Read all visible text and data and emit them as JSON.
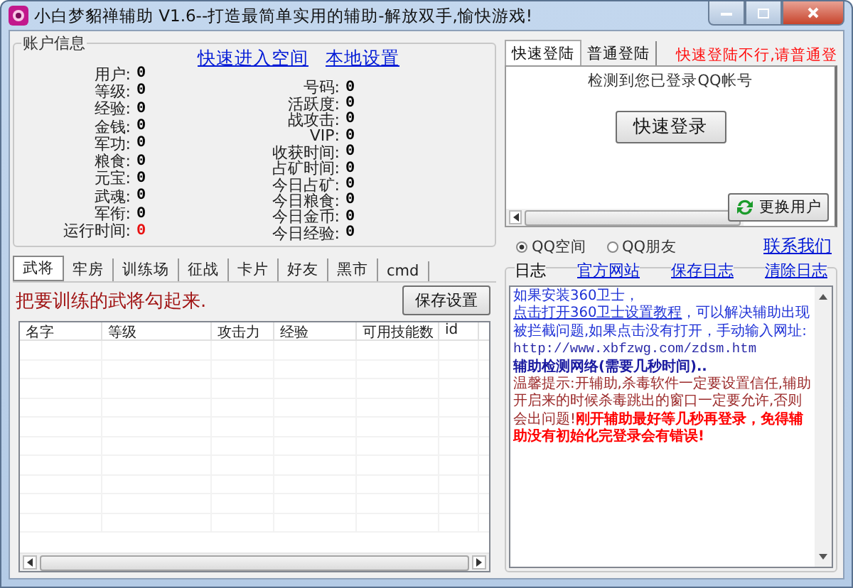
{
  "window": {
    "title": "小白梦貂禅辅助 V1.6--打造最简单实用的辅助-解放双手,愉快游戏!"
  },
  "account": {
    "title": "账户信息",
    "links": [
      "快速进入空间",
      "本地设置"
    ],
    "left_stats": [
      {
        "label": "用户:",
        "value": "0",
        "highlight": false
      },
      {
        "label": "等级:",
        "value": "0",
        "highlight": false
      },
      {
        "label": "经验:",
        "value": "0",
        "highlight": false
      },
      {
        "label": "金钱:",
        "value": "0",
        "highlight": false
      },
      {
        "label": "军功:",
        "value": "0",
        "highlight": false
      },
      {
        "label": "粮食:",
        "value": "0",
        "highlight": false
      },
      {
        "label": "元宝:",
        "value": "0",
        "highlight": false
      },
      {
        "label": "武魂:",
        "value": "0",
        "highlight": false
      },
      {
        "label": "军衔:",
        "value": "0",
        "highlight": false
      },
      {
        "label": "运行时间:",
        "value": "0",
        "highlight": true
      }
    ],
    "right_stats": [
      {
        "label": "号码:",
        "value": "0"
      },
      {
        "label": "活跃度:",
        "value": "0"
      },
      {
        "label": "战攻击:",
        "value": "0"
      },
      {
        "label": "VIP:",
        "value": "0"
      },
      {
        "label": "收获时间:",
        "value": "0"
      },
      {
        "label": "占矿时间:",
        "value": "0"
      },
      {
        "label": "今日占矿:",
        "value": "0"
      },
      {
        "label": "今日粮食:",
        "value": "0"
      },
      {
        "label": "今日金币:",
        "value": "0"
      },
      {
        "label": "今日经验:",
        "value": "0"
      }
    ]
  },
  "main_tabs": [
    {
      "label": "武将",
      "selected": true
    },
    {
      "label": "牢房",
      "selected": false
    },
    {
      "label": "训练场",
      "selected": false
    },
    {
      "label": "征战",
      "selected": false
    },
    {
      "label": "卡片",
      "selected": false
    },
    {
      "label": "好友",
      "selected": false
    },
    {
      "label": "黑市",
      "selected": false
    },
    {
      "label": "cmd",
      "selected": false
    }
  ],
  "hint": "把要训练的武将勾起来.",
  "save_button": "保存设置",
  "table": {
    "columns": [
      "名字",
      "等级",
      "攻击力",
      "经验",
      "可用技能数",
      "id"
    ]
  },
  "login": {
    "tabs": [
      {
        "label": "快速登陆",
        "selected": true
      },
      {
        "label": "普通登陆",
        "selected": false
      }
    ],
    "notice": "快速登陆不行,请普通登",
    "message": "检测到您已登录QQ帐号",
    "login_button": "快速登录",
    "switch_button": "更换用户"
  },
  "radios": [
    {
      "label": "QQ空间",
      "selected": true
    },
    {
      "label": "QQ朋友",
      "selected": false
    }
  ],
  "contact_link": "联系我们",
  "log": {
    "title": "日志",
    "links": [
      "官方网站",
      "保存日志",
      "清除日志"
    ],
    "messages": [
      [
        {
          "kind": "text",
          "text": "如果安装360卫士，"
        },
        {
          "kind": "link",
          "text": "点击打开360卫士设置教程"
        },
        {
          "kind": "text",
          "text": "，可以解决辅助出现被拦截问题,如果点击没有打开，手动输入网址:"
        }
      ],
      [
        {
          "kind": "url",
          "text": "http://www.xbfzwg.com/zdsm.htm"
        }
      ],
      [
        {
          "kind": "bold",
          "text": "辅助检测网络(需要几秒时间).."
        }
      ],
      [
        {
          "kind": "warn",
          "text": "温馨提示:开辅助,杀毒软件一定要设置信任,辅助开启来的时候杀毒跳出的窗口一定要允许,否则会出问题!"
        },
        {
          "kind": "alert",
          "text": "刚开辅助最好等几秒再登录，免得辅助没有初始化完登录会有错误!"
        }
      ]
    ]
  }
}
